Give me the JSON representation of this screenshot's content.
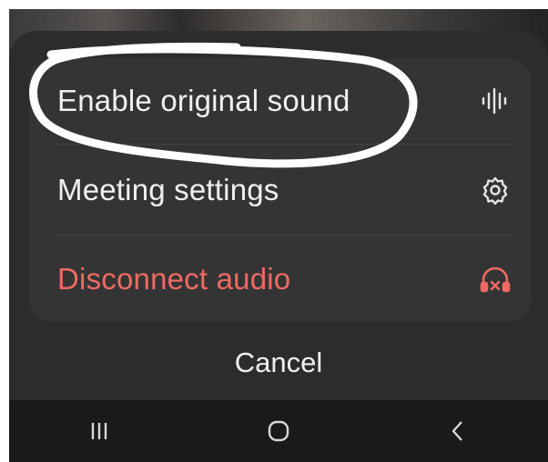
{
  "menu": {
    "items": [
      {
        "label": "Enable original sound",
        "icon": "audio-waveform-icon"
      },
      {
        "label": "Meeting settings",
        "icon": "gear-icon"
      },
      {
        "label": "Disconnect audio",
        "icon": "headphones-disconnect-icon"
      }
    ],
    "cancel_label": "Cancel"
  },
  "navbar": {
    "buttons": [
      "recent-apps-icon",
      "home-icon",
      "back-icon"
    ]
  },
  "colors": {
    "sheet_background": "#2c2c2d",
    "card_background": "#343435",
    "text": "#f0f0f0",
    "danger": "#ee6a63",
    "annotation": "#ffffff"
  }
}
